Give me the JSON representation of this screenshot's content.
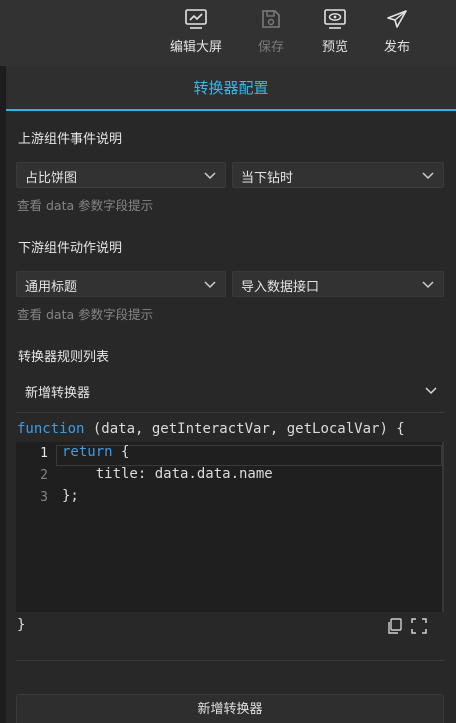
{
  "toolbar": {
    "edit_screen": "编辑大屏",
    "save": "保存",
    "preview": "预览",
    "publish": "发布"
  },
  "panel": {
    "title": "转换器配置",
    "upstream": {
      "title": "上游组件事件说明",
      "component": "占比饼图",
      "event": "当下钻时",
      "hint": "查看 data 参数字段提示"
    },
    "downstream": {
      "title": "下游组件动作说明",
      "component": "通用标题",
      "action": "导入数据接口",
      "hint": "查看 data 参数字段提示"
    },
    "rules": {
      "title": "转换器规则列表",
      "add_label": "新增转换器"
    },
    "code": {
      "keyword": "function",
      "signature": " (data, getInteractVar, getLocalVar) {",
      "lines": [
        {
          "num": "1",
          "kw": "return",
          "text": " {"
        },
        {
          "num": "2",
          "kw": "",
          "text": "    title: data.data.name"
        },
        {
          "num": "3",
          "kw": "",
          "text": "};"
        }
      ],
      "closing": "}"
    },
    "add_button": "新增转换器"
  },
  "colors": {
    "accent": "#36b8ea",
    "keyword": "#3a9ee8",
    "background": "#282828"
  },
  "icons": {
    "edit_screen": "chart-monitor-icon",
    "save": "save-disk-icon",
    "preview": "eye-monitor-icon",
    "publish": "paper-plane-icon",
    "copy": "copy-icon",
    "fullscreen": "fullscreen-icon"
  }
}
